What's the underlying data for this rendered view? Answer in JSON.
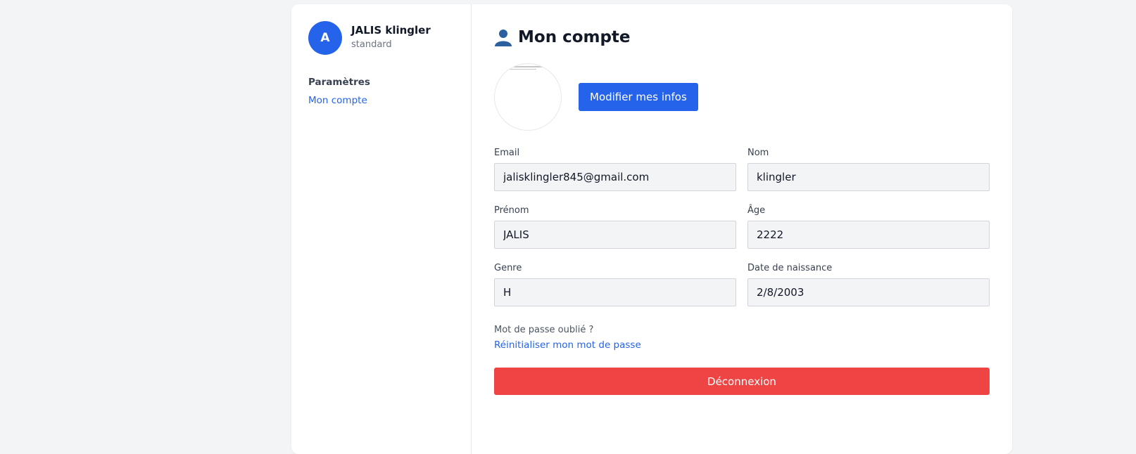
{
  "sidebar": {
    "avatar_initial": "A",
    "user_name": "JALIS klingler",
    "user_role": "standard",
    "section_title": "Paramètres",
    "nav_item": "Mon compte"
  },
  "main": {
    "title_icon": "user-icon",
    "title": "Mon compte",
    "edit_button": "Modifier mes infos",
    "fields": {
      "email": {
        "label": "Email",
        "value": "jalisklingler845@gmail.com"
      },
      "nom": {
        "label": "Nom",
        "value": "klingler"
      },
      "prenom": {
        "label": "Prénom",
        "value": "JALIS"
      },
      "age": {
        "label": "Âge",
        "value": "2222"
      },
      "genre": {
        "label": "Genre",
        "value": "H"
      },
      "naissance": {
        "label": "Date de naissance",
        "value": "2/8/2003"
      }
    },
    "forgot_text": "Mot de passe oublié ?",
    "reset_link": "Réinitialiser mon mot de passe",
    "logout_button": "Déconnexion"
  },
  "colors": {
    "accent": "#2563eb",
    "danger": "#ef4444",
    "background": "#f3f4f6"
  }
}
